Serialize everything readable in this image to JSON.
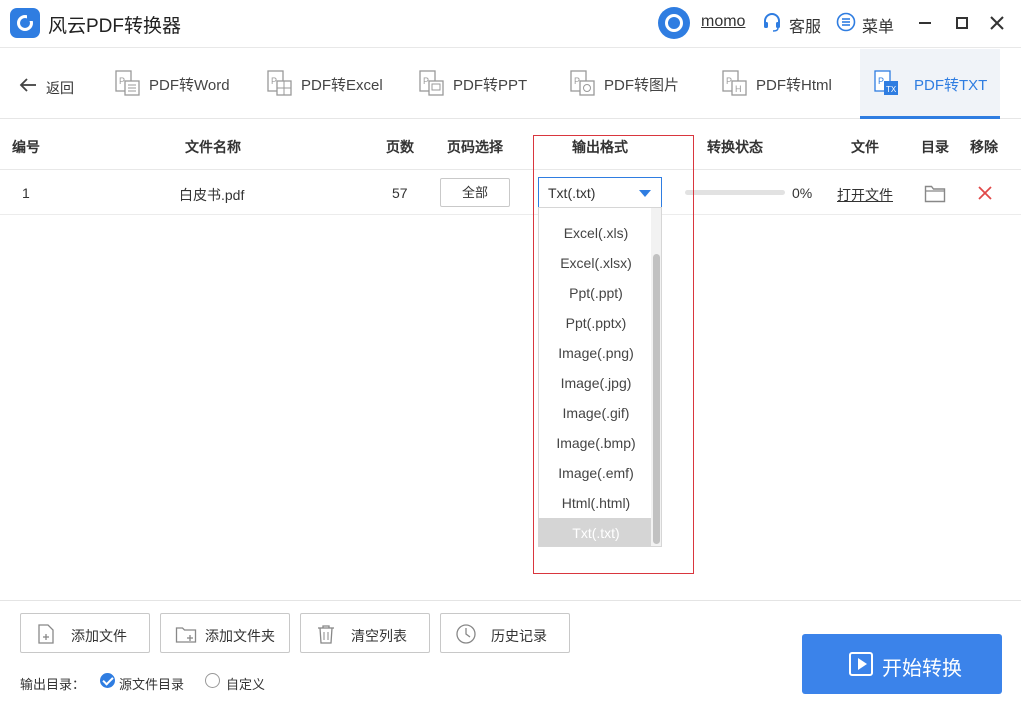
{
  "app": {
    "title": "风云PDF转换器"
  },
  "header": {
    "user": "momo",
    "service_label": "客服",
    "menu_label": "菜单"
  },
  "nav": {
    "back_label": "返回",
    "tabs": [
      {
        "label": "PDF转Word",
        "icon": "pdf-to-word-icon"
      },
      {
        "label": "PDF转Excel",
        "icon": "pdf-to-excel-icon"
      },
      {
        "label": "PDF转PPT",
        "icon": "pdf-to-ppt-icon"
      },
      {
        "label": "PDF转图片",
        "icon": "pdf-to-image-icon"
      },
      {
        "label": "PDF转Html",
        "icon": "pdf-to-html-icon"
      },
      {
        "label": "PDF转TXT",
        "icon": "pdf-to-txt-icon",
        "active": true
      }
    ]
  },
  "table": {
    "columns": [
      "编号",
      "文件名称",
      "页数",
      "页码选择",
      "输出格式",
      "转换状态",
      "文件",
      "目录",
      "移除"
    ],
    "rows": [
      {
        "index": "1",
        "filename": "白皮书.pdf",
        "pages": "57",
        "page_range": "全部",
        "format": "Txt(.txt)",
        "progress": 0,
        "progress_text": "0%",
        "open_file": "打开文件"
      }
    ]
  },
  "dropdown": {
    "options": [
      "Excel(.xls)",
      "Excel(.xlsx)",
      "Ppt(.ppt)",
      "Ppt(.pptx)",
      "Image(.png)",
      "Image(.jpg)",
      "Image(.gif)",
      "Image(.bmp)",
      "Image(.emf)",
      "Html(.html)",
      "Txt(.txt)"
    ],
    "selected": "Txt(.txt)"
  },
  "toolbar": {
    "add_file": "添加文件",
    "add_folder": "添加文件夹",
    "clear_list": "清空列表",
    "history": "历史记录"
  },
  "output": {
    "label": "输出目录：",
    "options": [
      "源文件目录",
      "自定义"
    ],
    "selected": "源文件目录"
  },
  "start_label": "开始转换",
  "colors": {
    "accent": "#2f7de1",
    "highlight": "#d9363e",
    "remove": "#e04848"
  }
}
